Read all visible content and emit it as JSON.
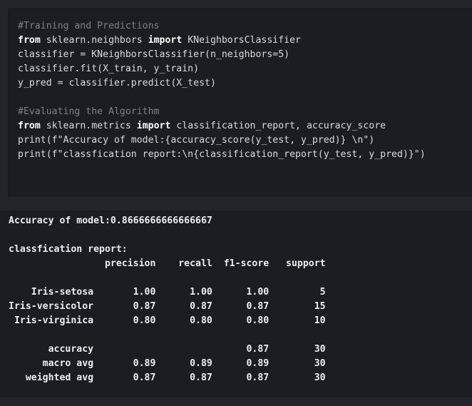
{
  "code_cell": {
    "lines": [
      "#Training and Predictions",
      "from sklearn.neighbors import KNeighborsClassifier",
      "classifier = KNeighborsClassifier(n_neighbors=5)",
      "classifier.fit(X_train, y_train)",
      "y_pred = classifier.predict(X_test)",
      "",
      "#Evaluating the Algorithm",
      "from sklearn.metrics import classification_report, accuracy_score",
      "print(f\"Accuracy of model:{accuracy_score(y_test, y_pred)} \\n\")",
      "print(f\"classfication report:\\n{classification_report(y_test, y_pred)}\")"
    ]
  },
  "output_cell": {
    "lines": [
      "Accuracy of model:0.8666666666666667",
      "",
      "classfication report:",
      "                 precision    recall  f1-score   support",
      "",
      "    Iris-setosa       1.00      1.00      1.00         5",
      "Iris-versicolor       0.87      0.87      0.87        15",
      " Iris-virginica       0.80      0.80      0.80        10",
      "",
      "       accuracy                           0.87        30",
      "      macro avg       0.89      0.89      0.89        30",
      "   weighted avg       0.87      0.87      0.87        30"
    ]
  }
}
